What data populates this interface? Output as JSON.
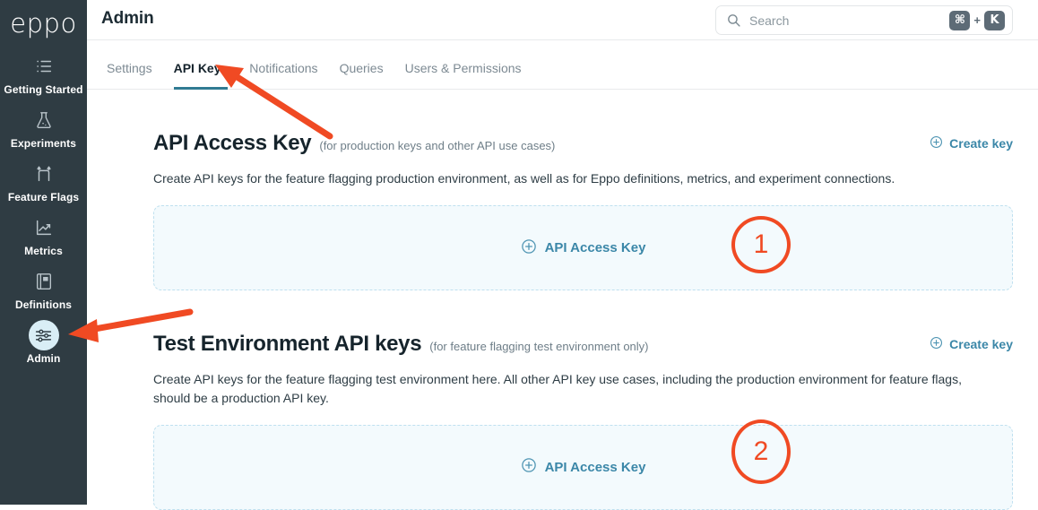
{
  "sidebar": {
    "logo": "eppo",
    "items": [
      {
        "label": "Getting Started",
        "icon": "list-icon",
        "active": false
      },
      {
        "label": "Experiments",
        "icon": "flask-icon",
        "active": false
      },
      {
        "label": "Feature Flags",
        "icon": "flag-branch-icon",
        "active": false
      },
      {
        "label": "Metrics",
        "icon": "chart-trend-icon",
        "active": false
      },
      {
        "label": "Definitions",
        "icon": "book-icon",
        "active": false
      },
      {
        "label": "Admin",
        "icon": "sliders-icon",
        "active": true
      }
    ]
  },
  "header": {
    "title": "Admin",
    "search": {
      "placeholder": "Search",
      "value": "",
      "icon": "search-icon",
      "shortcut_key": "⌘",
      "shortcut_plus": "+",
      "shortcut_letter": "K"
    }
  },
  "tabs": [
    {
      "label": "Settings",
      "active": false
    },
    {
      "label": "API Keys",
      "active": true
    },
    {
      "label": "Notifications",
      "active": false
    },
    {
      "label": "Queries",
      "active": false
    },
    {
      "label": "Users & Permissions",
      "active": false
    }
  ],
  "sections": [
    {
      "title": "API Access Key",
      "note": "(for production keys and other API use cases)",
      "create_label": "Create key",
      "create_icon": "circle-plus-icon",
      "description": "Create API keys for the feature flagging production environment, as well as for Eppo definitions, metrics, and experiment connections.",
      "card_label": "API Access Key",
      "card_icon": "circle-plus-icon"
    },
    {
      "title": "Test Environment API keys",
      "note": "(for feature flagging test environment only)",
      "create_label": "Create key",
      "create_icon": "circle-plus-icon",
      "description": "Create API keys for the feature flagging test environment here. All other API key use cases, including the production environment for feature flags, should be a production API key.",
      "card_label": "API Access Key",
      "card_icon": "circle-plus-icon"
    }
  ],
  "annotations": {
    "color": "#f04a23",
    "badges": [
      {
        "label": "1"
      },
      {
        "label": "2"
      }
    ],
    "arrows": [
      {
        "name": "arrow-to-api-keys-tab"
      },
      {
        "name": "arrow-to-admin-nav"
      }
    ]
  },
  "theme": {
    "sidebar_bg": "#2f3c43",
    "accent_teal": "#307b93",
    "link_blue": "#3b87a8",
    "card_bg": "#f3fafd",
    "card_border": "#bfe0ef",
    "annotation_orange": "#f04a23"
  }
}
